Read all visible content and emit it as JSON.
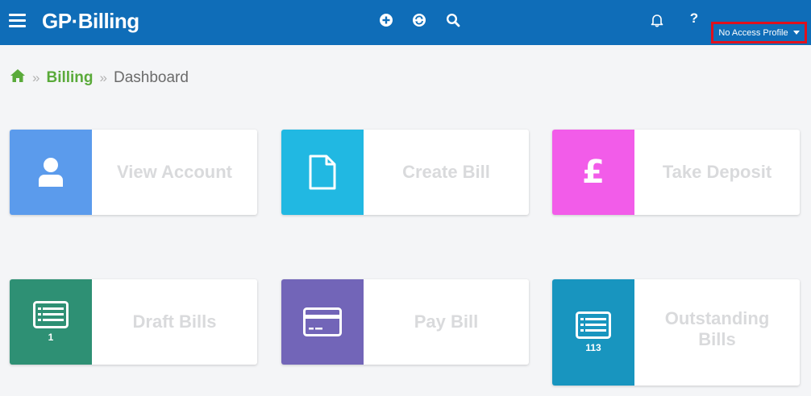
{
  "header": {
    "brand": "GP·Billing",
    "profile_label": "No Access Profile",
    "icons": [
      "menu-icon",
      "add-icon",
      "sync-icon",
      "search-icon",
      "bell-icon",
      "help-icon"
    ]
  },
  "breadcrumb": {
    "separator": "»",
    "section": "Billing",
    "current": "Dashboard"
  },
  "tiles": [
    {
      "label": "View Account",
      "icon": "user-icon",
      "color": "#5b9bec",
      "count": ""
    },
    {
      "label": "Create Bill",
      "icon": "document-icon",
      "color": "#21b8e2",
      "count": ""
    },
    {
      "label": "Take Deposit",
      "icon": "pound-icon",
      "glyph": "£",
      "color": "#f25ce9",
      "count": ""
    },
    {
      "label": "Draft Bills",
      "icon": "list-card-icon",
      "color": "#2e9074",
      "count": "1"
    },
    {
      "label": "Pay Bill",
      "icon": "credit-card-icon",
      "color": "#7265b8",
      "count": ""
    },
    {
      "label": "Outstanding Bills",
      "icon": "list-card-icon",
      "color": "#1895bf",
      "count": "113"
    }
  ],
  "colors": {
    "header_bg": "#0f6db8",
    "profile_outline": "#e0101c",
    "breadcrumb_link": "#5aaa3a",
    "tile_label": "#d9dadc"
  }
}
